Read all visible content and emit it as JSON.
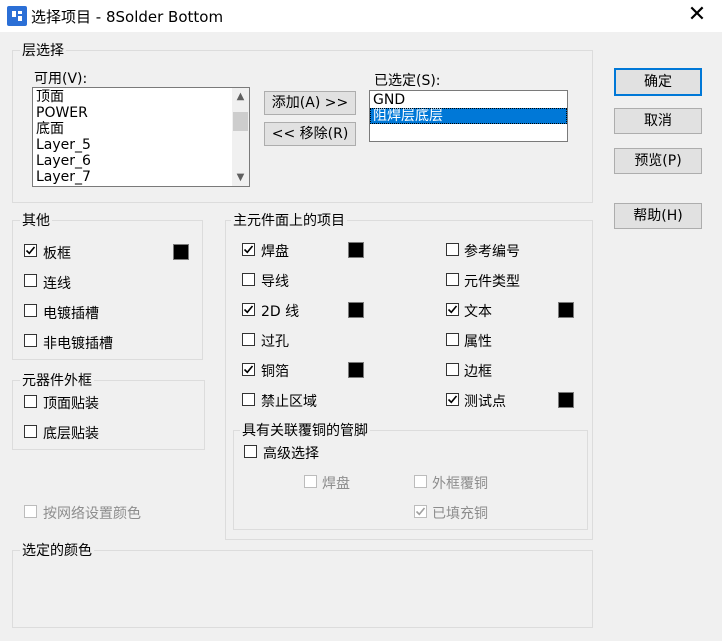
{
  "window": {
    "title": "选择项目 - 8Solder Bottom",
    "close_glyph": "✕"
  },
  "layer_select": {
    "legend": "层选择",
    "available_label": "可用(V):",
    "available_items": [
      "顶面",
      "POWER",
      "底面",
      "Layer_5",
      "Layer_6",
      "Layer_7"
    ],
    "selected_label": "已选定(S):",
    "selected_items": [
      "GND",
      "阻焊层底层"
    ],
    "add_button": "添加(A) >>",
    "remove_button": "<< 移除(R)"
  },
  "buttons": {
    "ok": "确定",
    "cancel": "取消",
    "preview": "预览(P)",
    "help": "帮助(H)"
  },
  "other": {
    "legend": "其他",
    "board_outline": "板框",
    "connections": "连线",
    "plated_slots": "电镀插槽",
    "nonplated_slots": "非电镀插槽"
  },
  "component_outline": {
    "legend": "元器件外框",
    "top_smd": "顶面贴装",
    "bottom_smd": "底层贴装"
  },
  "main_side": {
    "legend": "主元件面上的项目",
    "pads": "焊盘",
    "traces": "导线",
    "lines_2d": "2D 线",
    "vias": "过孔",
    "copper": "铜箔",
    "keepout": "禁止区域",
    "ref_des": "参考编号",
    "part_type": "元件类型",
    "text": "文本",
    "attributes": "属性",
    "borders": "边框",
    "test_points": "测试点"
  },
  "pins": {
    "legend": "具有关联覆铜的管脚",
    "advanced": "高级选择",
    "pad": "焊盘",
    "outline_pour": "外框覆铜",
    "filled_copper": "已填充铜"
  },
  "net_color": "按网络设置颜色",
  "selected_colors": {
    "legend": "选定的颜色"
  },
  "colors": {
    "accent": "#0078d7",
    "swatch": "#000000"
  }
}
